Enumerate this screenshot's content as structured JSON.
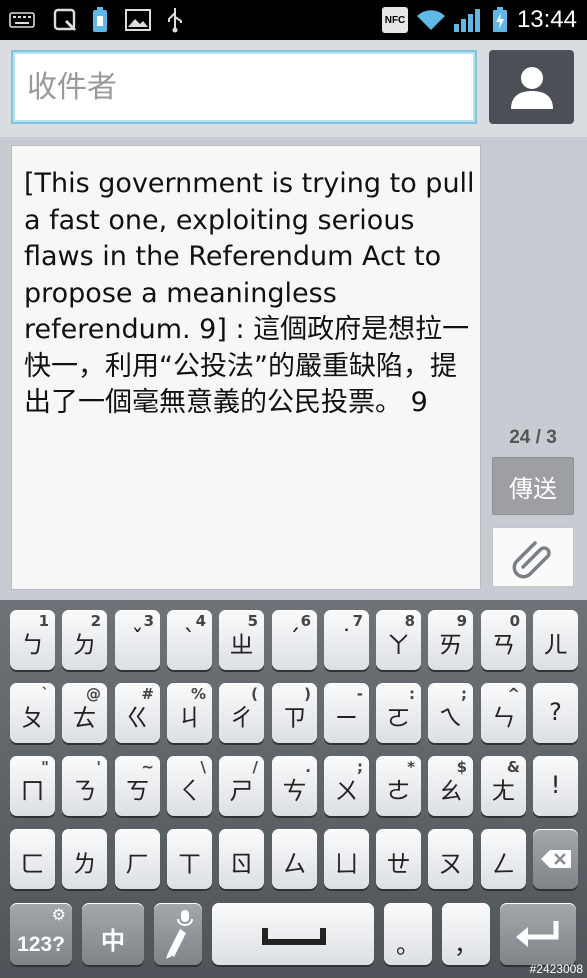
{
  "status_bar": {
    "time": "13:44",
    "nfc_label": "NFC",
    "icons": [
      "keyboard-icon",
      "screenshot-icon",
      "battery-saver-icon",
      "image-icon",
      "usb-icon",
      "nfc-icon",
      "wifi-icon",
      "signal-icon",
      "battery-icon"
    ]
  },
  "recipient": {
    "placeholder": "收件者"
  },
  "message": {
    "text": "[This government is trying to pull a fast one, exploiting serious flaws in the Referendum Act to propose a meaningless referendum. 9] : 這個政府是想拉一快一，利用“公投法”的嚴重缺陷，提出了一個毫無意義的公民投票。 9"
  },
  "counter": "24 / 3",
  "send_label": "傳送",
  "keyboard": {
    "row1": [
      {
        "main": "ㄅ",
        "sub": "1"
      },
      {
        "main": "ㄉ",
        "sub": "2"
      },
      {
        "main": "ˇ",
        "sub": "3"
      },
      {
        "main": "ˋ",
        "sub": "4"
      },
      {
        "main": "ㄓ",
        "sub": "5"
      },
      {
        "main": "ˊ",
        "sub": "6"
      },
      {
        "main": "˙",
        "sub": "7"
      },
      {
        "main": "ㄚ",
        "sub": "8"
      },
      {
        "main": "ㄞ",
        "sub": "9"
      },
      {
        "main": "ㄢ",
        "sub": "0"
      },
      {
        "main": "ㄦ",
        "sub": ""
      }
    ],
    "row2": [
      {
        "main": "ㄆ",
        "sub": "`"
      },
      {
        "main": "ㄊ",
        "sub": "@"
      },
      {
        "main": "ㄍ",
        "sub": "#"
      },
      {
        "main": "ㄐ",
        "sub": "%"
      },
      {
        "main": "ㄔ",
        "sub": "("
      },
      {
        "main": "ㄗ",
        "sub": ")"
      },
      {
        "main": "ㄧ",
        "sub": "-"
      },
      {
        "main": "ㄛ",
        "sub": ":"
      },
      {
        "main": "ㄟ",
        "sub": ";"
      },
      {
        "main": "ㄣ",
        "sub": "^"
      },
      {
        "main": "?",
        "sub": ""
      }
    ],
    "row3": [
      {
        "main": "ㄇ",
        "sub": "\""
      },
      {
        "main": "ㄋ",
        "sub": "'"
      },
      {
        "main": "ㄎ",
        "sub": "~"
      },
      {
        "main": "ㄑ",
        "sub": "\\"
      },
      {
        "main": "ㄕ",
        "sub": "/"
      },
      {
        "main": "ㄘ",
        "sub": "."
      },
      {
        "main": "ㄨ",
        "sub": ";"
      },
      {
        "main": "ㄜ",
        "sub": "*"
      },
      {
        "main": "ㄠ",
        "sub": "$"
      },
      {
        "main": "ㄤ",
        "sub": "&"
      },
      {
        "main": "!",
        "sub": ""
      }
    ],
    "row4": [
      {
        "main": "ㄈ",
        "sub": ""
      },
      {
        "main": "ㄌ",
        "sub": ""
      },
      {
        "main": "ㄏ",
        "sub": ""
      },
      {
        "main": "ㄒ",
        "sub": ""
      },
      {
        "main": "ㄖ",
        "sub": ""
      },
      {
        "main": "ㄙ",
        "sub": ""
      },
      {
        "main": "ㄩ",
        "sub": ""
      },
      {
        "main": "ㄝ",
        "sub": ""
      },
      {
        "main": "ㄡ",
        "sub": ""
      },
      {
        "main": "ㄥ",
        "sub": ""
      }
    ],
    "symbols_label": "123?",
    "lang_label": "中",
    "period_label": "。",
    "comma_label": "，"
  },
  "watermark": "#2423008"
}
